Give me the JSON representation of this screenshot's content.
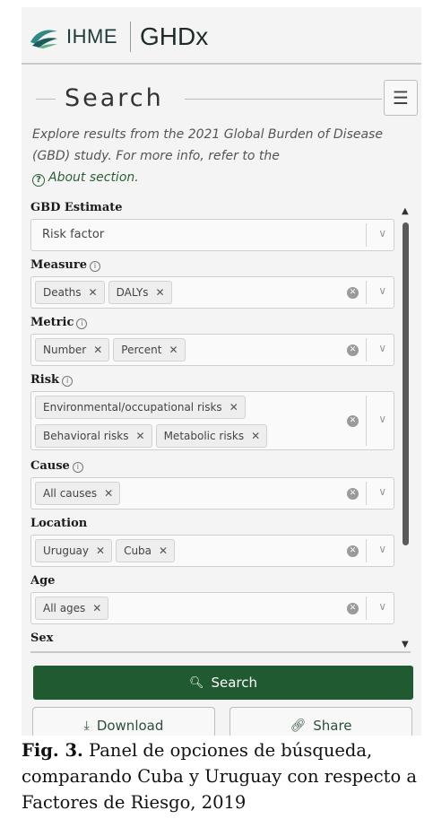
{
  "header": {
    "brand_left": "IHME",
    "brand_right": "GHDx",
    "logo_icon": "ihme-logo-icon"
  },
  "search_title": "Search",
  "intro": {
    "text": "Explore results from the 2021 Global Burden of Disease (GBD) study. For more info, refer to the",
    "about_link": "About section."
  },
  "filters": {
    "gbd_estimate": {
      "label": "GBD Estimate",
      "value": "Risk factor"
    },
    "measure": {
      "label": "Measure",
      "chips": [
        "Deaths",
        "DALYs"
      ]
    },
    "metric": {
      "label": "Metric",
      "chips": [
        "Number",
        "Percent"
      ]
    },
    "risk": {
      "label": "Risk",
      "chips": [
        "Environmental/occupational risks",
        "Behavioral risks",
        "Metabolic risks"
      ]
    },
    "cause": {
      "label": "Cause",
      "chips": [
        "All causes"
      ]
    },
    "location": {
      "label": "Location",
      "chips": [
        "Uruguay",
        "Cuba"
      ]
    },
    "age": {
      "label": "Age",
      "chips": [
        "All ages"
      ]
    },
    "sex": {
      "label": "Sex"
    }
  },
  "buttons": {
    "search": "Search",
    "download": "Download",
    "share": "Share"
  },
  "caption": {
    "label": "Fig. 3.",
    "text": "Panel de opciones de búsqueda, comparando Cuba y Uruguay con respecto a Factores de Riesgo, 2019"
  },
  "colors": {
    "primary_green": "#1f5a30",
    "panel_bg": "#f4f4f4"
  }
}
